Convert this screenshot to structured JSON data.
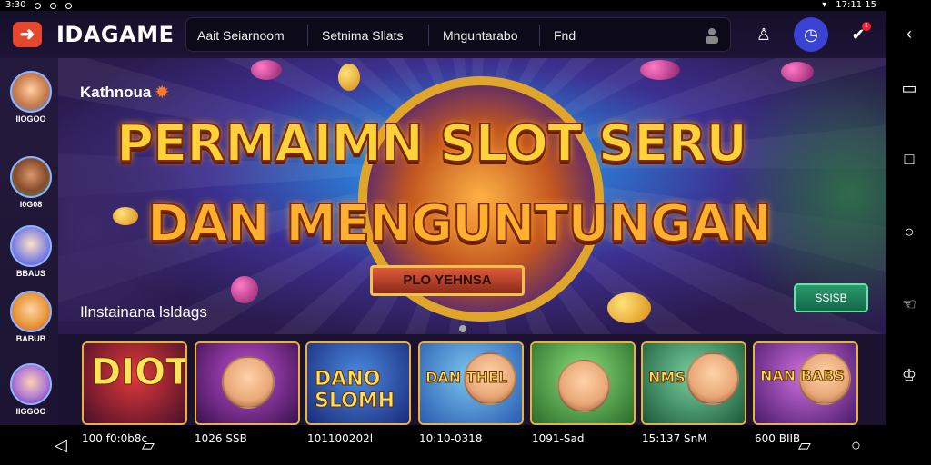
{
  "status_bar": {
    "time": "3:30",
    "right_text": "17:11 15"
  },
  "header": {
    "back_icon": "arrow-left-icon",
    "logo": "IDAGAME",
    "tabs": [
      "Aait Seiarnoom",
      "Setnima Sllats",
      "Mnguntarabo",
      "Fnd"
    ],
    "user_icon": "user-icon",
    "icons": [
      "trophy-icon",
      "clock-icon",
      "gift-icon"
    ],
    "badge_count": "1"
  },
  "sidebar": {
    "items": [
      {
        "label": "IIOGOO"
      },
      {
        "label": "I0G08"
      },
      {
        "label": "BBAUS"
      },
      {
        "label": "BABUB"
      },
      {
        "label": "IIGGOO"
      }
    ]
  },
  "banner": {
    "subtitle": "Kathnoua",
    "headline_line1": "PERMAIMN SLOT SERU",
    "headline_line2": "DAN MENGUNTUNGAN",
    "ribbon": "PLO YEHNSA",
    "caption": "Ilnstainana lsldags",
    "cta": "SSISB"
  },
  "games": [
    {
      "title": "DIOT",
      "bg": "#a02a2a"
    },
    {
      "title": "",
      "bg": "#8a2a9b"
    },
    {
      "title": "DANO SLOMH",
      "bg": "#2a55c4"
    },
    {
      "title": "DAN THEL",
      "bg": "#3a9ad9"
    },
    {
      "title": "",
      "bg": "#5fa63a"
    },
    {
      "title": "NMS",
      "bg": "#3aa64a"
    },
    {
      "title": "NAN BABS",
      "bg": "#9b2ab0"
    }
  ],
  "bottom_bar": {
    "labels": [
      "100 f0:0b8c",
      "1026 SSB",
      "101100202l",
      "10:10-0318",
      "1091-Sad",
      "15:137 SnM",
      "600 BIIB"
    ]
  },
  "right_bar": {
    "icons": [
      "back-chevron-icon",
      "split-screen-icon",
      "square-icon",
      "circle-icon",
      "hand-icon",
      "crown-icon",
      "menu-icon"
    ]
  },
  "colors": {
    "accent": "#e5472d",
    "header_bg": "#151029",
    "nav_bg": "#0c0a18",
    "circle_button": "#3b43d6",
    "cta_green": "#2a9b6b"
  }
}
